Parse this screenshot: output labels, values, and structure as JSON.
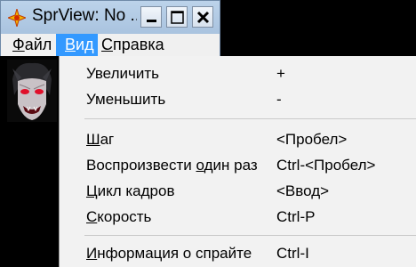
{
  "window": {
    "title": "SprView: No ...",
    "buttons": {
      "minimize": "minimize",
      "maximize": "maximize",
      "close": "close"
    }
  },
  "menubar": {
    "file": {
      "accel": "Ф",
      "rest": "айл"
    },
    "view": {
      "accel": "В",
      "rest": "ид"
    },
    "help": {
      "accel": "С",
      "rest": "правка"
    }
  },
  "view_menu": {
    "zoom_in": {
      "pre": "Увеличить",
      "accel": "",
      "post": "",
      "shortcut": "+"
    },
    "zoom_out": {
      "pre": "Уменьшить",
      "accel": "",
      "post": "",
      "shortcut": "-"
    },
    "step": {
      "pre": "",
      "accel": "Ш",
      "post": "аг",
      "shortcut": "<Пробел>"
    },
    "play_once": {
      "pre": "Воспроизвести ",
      "accel": "о",
      "post": "дин раз",
      "shortcut": "Ctrl-<Пробел>"
    },
    "loop": {
      "pre": "",
      "accel": "Ц",
      "post": "икл кадров",
      "shortcut": "<Ввод>"
    },
    "speed": {
      "pre": "",
      "accel": "С",
      "post": "корость",
      "shortcut": "Ctrl-P"
    },
    "sprite_info": {
      "pre": "",
      "accel": "И",
      "post": "нформация о спрайте",
      "shortcut": "Ctrl-I"
    }
  },
  "colors": {
    "menu_highlight": "#3399ff",
    "menu_background": "#f2f2f2",
    "titlebar": "#b5cde6"
  }
}
